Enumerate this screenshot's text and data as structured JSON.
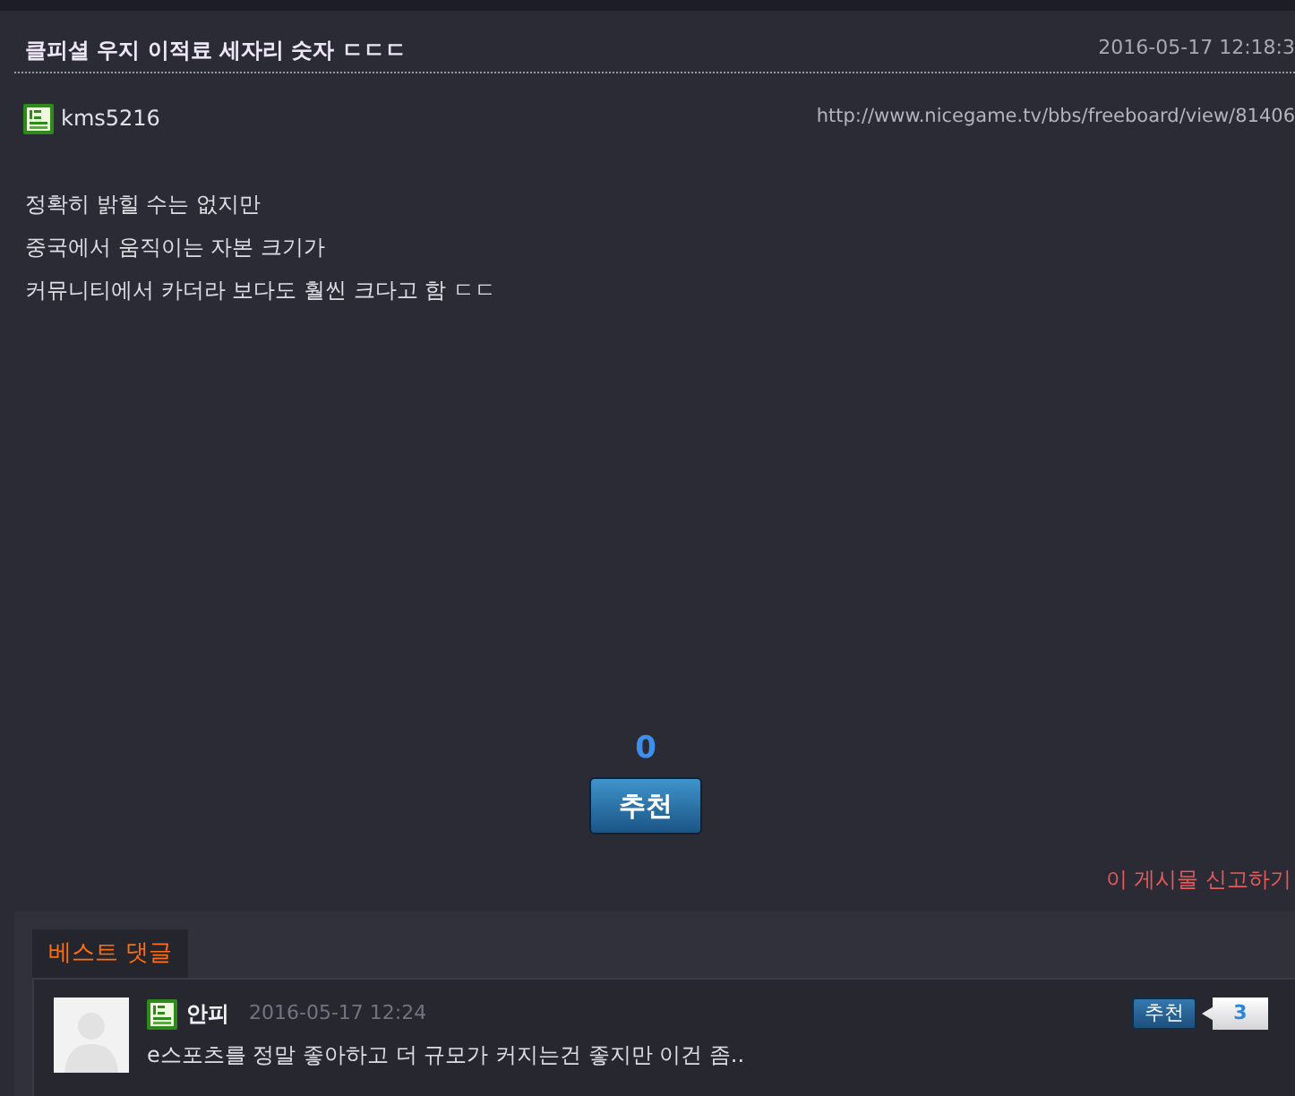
{
  "post": {
    "title": "클피셜 우지 이적료 세자리 숫자 ㄷㄷㄷ",
    "date": "2016-05-17 12:18:3",
    "author": "kms5216",
    "url": "http://www.nicegame.tv/bbs/freeboard/view/81406",
    "body": [
      "정확히 밝힐 수는 없지만",
      "중국에서 움직이는 자본 크기가",
      "커뮤니티에서 카더라 보다도 훨씬 크다고 함 ㄷㄷ"
    ],
    "recommend_count": "0",
    "recommend_button": "추천",
    "report_link": "이 게시물 신고하기"
  },
  "best_comments": {
    "tab": "베스트 댓글",
    "comments": [
      {
        "author": "안피",
        "date": "2016-05-17 12:24",
        "text": "e스포츠를 정말 좋아하고 더 규모가 커지는건 좋지만 이건 좀..",
        "recommend_button": "추천",
        "recommend_count": "3"
      }
    ]
  }
}
